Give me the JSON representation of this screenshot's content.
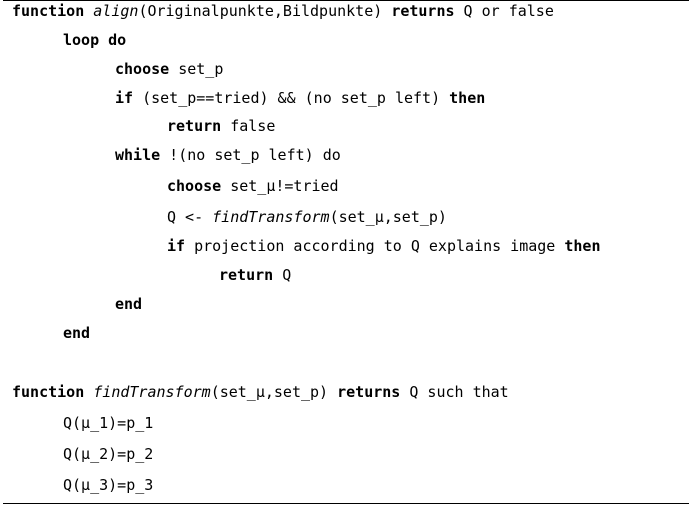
{
  "code": {
    "align_block": {
      "line1": {
        "kw_function": "function",
        "name": "align",
        "params": "(Originalpunkte,Bildpunkte) ",
        "kw_returns": "returns",
        "rest": " Q or false"
      },
      "line2": {
        "kw_loop": "loop do"
      },
      "line3": {
        "kw_choose": "choose",
        "rest": " set_p"
      },
      "line4": {
        "kw_if": "if",
        "cond": " (set_p==tried) && (no set_p left) ",
        "kw_then": "then"
      },
      "line5": {
        "kw_return": "return",
        "rest": " false"
      },
      "line6": {
        "kw_while": "while",
        "rest": " !(no set_p left) do"
      },
      "line7": {
        "kw_choose": "choose",
        "rest": " set_μ!=tried"
      },
      "line8": {
        "lhs": "Q <- ",
        "name": "findTransform",
        "rest": "(set_μ,set_p)"
      },
      "line9": {
        "kw_if": "if",
        "cond": " projection according to Q explains image ",
        "kw_then": "then"
      },
      "line10": {
        "kw_return": "return",
        "rest": " Q"
      },
      "line11": {
        "kw_end": "end"
      },
      "line12": {
        "kw_end": "end"
      }
    },
    "find_block": {
      "line1": {
        "kw_function": "function",
        "name": "findTransform",
        "params": "(set_μ,set_p) ",
        "kw_returns": "returns",
        "rest": " Q such that"
      },
      "line2": {
        "text": "Q(μ_1)=p_1"
      },
      "line3": {
        "text": "Q(μ_2)=p_2"
      },
      "line4": {
        "text": "Q(μ_3)=p_3"
      }
    }
  }
}
